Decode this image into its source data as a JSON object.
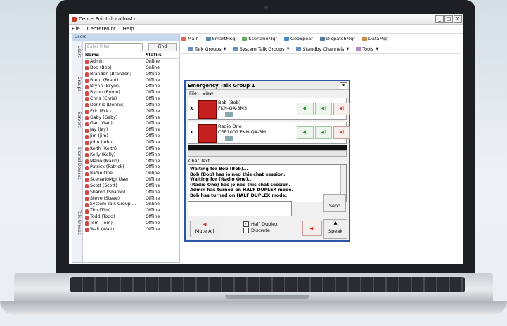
{
  "window": {
    "title": "CenterPoint (localhost)",
    "min": "_",
    "max": "□",
    "close": "X"
  },
  "menu": [
    "File",
    "CenterPoint",
    "Help"
  ],
  "left": {
    "header": "Users",
    "filter_placeholder": "Enter filter",
    "find_label": "Find",
    "vtabs": [
      "Users",
      "Groups",
      "Servers",
      "Shared Devices",
      "Talk Groups"
    ],
    "columns": [
      "Name",
      "Status"
    ],
    "users": [
      {
        "name": "Admin",
        "status": "Online"
      },
      {
        "name": "Bob (Bob)",
        "status": "Online"
      },
      {
        "name": "Brandon (Brandon)",
        "status": "Offline"
      },
      {
        "name": "Brent (Brent)",
        "status": "Offline"
      },
      {
        "name": "Brynn (Brynn)",
        "status": "Offline"
      },
      {
        "name": "Byron (Byron)",
        "status": "Offline"
      },
      {
        "name": "Chris (Chris)",
        "status": "Offline"
      },
      {
        "name": "Dennis (Dennis)",
        "status": "Offline"
      },
      {
        "name": "Eric (Eric)",
        "status": "Offline"
      },
      {
        "name": "Gaby (Gaby)",
        "status": "Offline"
      },
      {
        "name": "Gan (Gan)",
        "status": "Offline"
      },
      {
        "name": "Jay (Jay)",
        "status": "Offline"
      },
      {
        "name": "Jim (Jim)",
        "status": "Offline"
      },
      {
        "name": "John (John)",
        "status": "Offline"
      },
      {
        "name": "Keith (Keith)",
        "status": "Offline"
      },
      {
        "name": "Kelly (Kelly)",
        "status": "Offline"
      },
      {
        "name": "Mario (Mario)",
        "status": "Offline"
      },
      {
        "name": "Patrick (Patrick)",
        "status": "Offline"
      },
      {
        "name": "Radio One",
        "status": "Online"
      },
      {
        "name": "ScenarioMgr User",
        "status": "Offline"
      },
      {
        "name": "Scott (Scott)",
        "status": "Offline"
      },
      {
        "name": "Sharon (Sharon)",
        "status": "Offline"
      },
      {
        "name": "Steve (Steve)",
        "status": "Offline"
      },
      {
        "name": "System Talk Group ...",
        "status": "Online"
      },
      {
        "name": "Tim (Tim)",
        "status": "Offline"
      },
      {
        "name": "Todd (Todd)",
        "status": "Offline"
      },
      {
        "name": "Tom (Tom)",
        "status": "Offline"
      },
      {
        "name": "Walt (Walt)",
        "status": "Offline"
      }
    ]
  },
  "tabs": [
    "Main",
    "SmartMsg",
    "ScenarioMgr",
    "GeoSpear",
    "DispatchMgr",
    "DataMgr"
  ],
  "tools": [
    "Talk Groups",
    "System Talk Groups",
    "Standby Channels",
    "Tools"
  ],
  "dialog": {
    "title": "Emergency Talk Group 1",
    "menu": [
      "File",
      "View"
    ],
    "members": [
      {
        "name": "Bob (Bob)",
        "device": "FKN-QA-3M3"
      },
      {
        "name": "Radio One",
        "device": "CSP1001.FKN-QA-3M"
      }
    ],
    "chat_label": "Chat Text :",
    "chat_lines": [
      "Waiting for Bob (Bob)...",
      "Bob (Bob) has joined this chat session.",
      "Waiting for  (Radio One)...",
      " (Radio One) has joined this chat session.",
      "Admin has turned on HALF DUPLEX mode.",
      "Bob has turned on HALF DUPLEX mode."
    ],
    "send_label": "Send",
    "mute_label": "Mute All",
    "half_duplex_label": "Half Duplex",
    "discrete_label": "Discrete",
    "speak_label": "Speak"
  }
}
